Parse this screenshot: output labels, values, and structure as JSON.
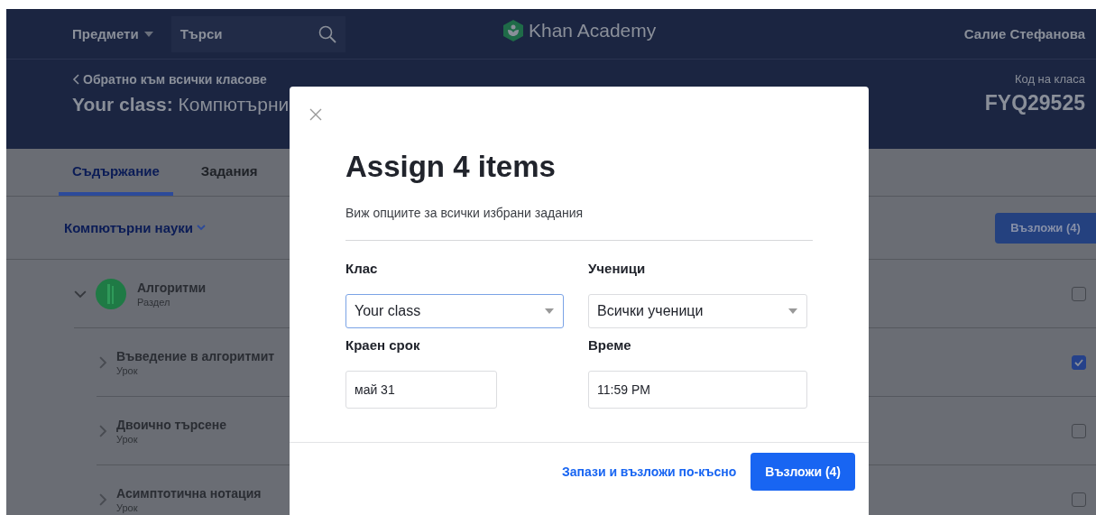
{
  "nav": {
    "subjects": "Предмети",
    "search": {
      "placeholder": "Търси"
    },
    "logo": "Khan Academy",
    "user": "Салие Стефанова"
  },
  "class_header": {
    "back": "Обратно към всички класове",
    "title": "**Your class:** Компютърни",
    "code_label": "Код на класа",
    "code": "FYQ29525"
  },
  "tabs": [
    {
      "label": "Съдържание",
      "selected": true
    },
    {
      "label": "Задания",
      "selected": false
    }
  ],
  "course": {
    "label": "Компютърни науки",
    "assign_button": "Възложи (4)"
  },
  "items": [
    {
      "kind": "unit",
      "title": "Алгоритми",
      "type": "Раздел",
      "expanded": true,
      "checked": false
    },
    {
      "kind": "lesson",
      "title": "Въведение в алгоритмит",
      "type": "Урок",
      "expanded": false,
      "checked": true
    },
    {
      "kind": "lesson",
      "title": "Двоично търсене",
      "type": "Урок",
      "expanded": false,
      "checked": false
    },
    {
      "kind": "lesson",
      "title": "Асимптотична нотация",
      "type": "Урок",
      "expanded": false,
      "checked": false
    }
  ],
  "modal": {
    "title": "Assign 4 items",
    "subtitle": "Виж опциите за всички избрани задания",
    "fields": [
      {
        "kind": "select",
        "label": "Клас",
        "value": "Your class",
        "focused": true
      },
      {
        "kind": "select",
        "label": "Ученици",
        "value": "Всички ученици",
        "focused": false
      },
      {
        "kind": "date",
        "label": "Краен срок",
        "value": "май 31",
        "focused": false
      },
      {
        "kind": "time",
        "label": "Време",
        "value": "11:59 PM",
        "focused": false
      }
    ],
    "secondary_button": "Запази и възложи по-късно",
    "primary_button": "Възложи (4)"
  }
}
